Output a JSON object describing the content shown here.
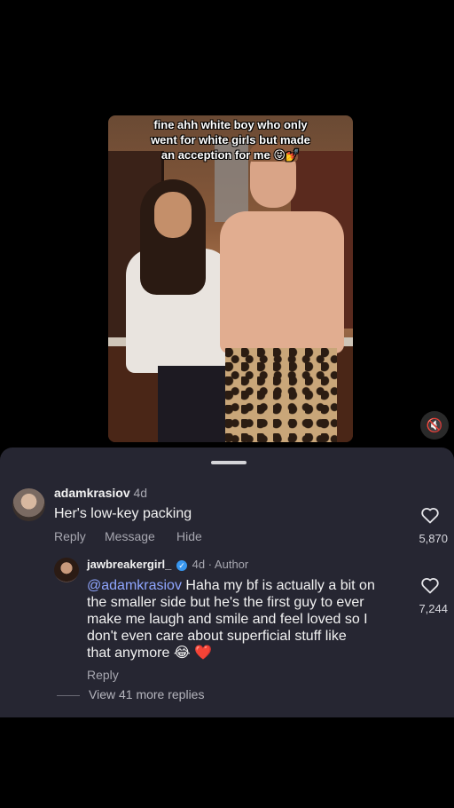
{
  "video": {
    "caption_line1": "fine ahh white boy who only",
    "caption_line2": "went for white girls but made",
    "caption_line3": "an acception for me 😝💅",
    "mute_icon": "volume-muted-icon"
  },
  "comments": [
    {
      "username": "adamkrasiov",
      "time": "4d",
      "text": "Her's low-key packing",
      "actions": [
        "Reply",
        "Message",
        "Hide"
      ],
      "likes": "5,870"
    },
    {
      "username": "jawbreakergirl_",
      "time": "4d · Author",
      "mention": "@adamkrasiov",
      "text_line1": " Haha my bf is actually a bit on",
      "text_line2": "the smaller side but he's the first guy to ever",
      "text_line3": "make me laugh and smile and feel loved so I",
      "text_line4": "don't even care about superficial stuff like",
      "text_line5": "that anymore 😂 ❤️",
      "reply": "Reply",
      "likes": "7,244"
    }
  ],
  "view_more": "View 41 more replies",
  "colors": {
    "sheet": "#262632",
    "mention": "#8fa6ff",
    "muted_text": "#a7a7b0",
    "verified": "#3897f0"
  }
}
